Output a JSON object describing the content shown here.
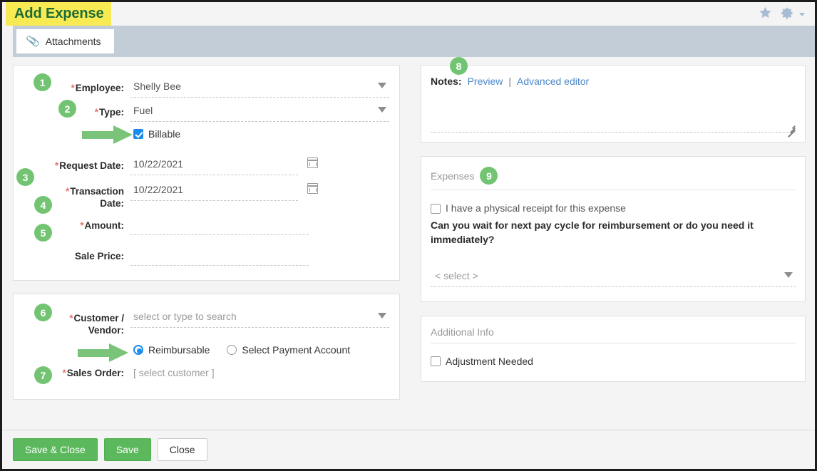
{
  "window": {
    "title": "Add Expense",
    "star_icon": "star-icon",
    "gear_icon": "gear-icon",
    "caret_icon": "chevron-down-icon"
  },
  "tabs": [
    {
      "label": "Attachments",
      "icon": "paperclip-icon",
      "active": true
    }
  ],
  "form": {
    "employee": {
      "badge": "1",
      "label": "Employee:",
      "required": true,
      "value": "Shelly Bee",
      "placeholder": ""
    },
    "type": {
      "badge": "2",
      "label": "Type:",
      "required": true,
      "value": "Fuel",
      "placeholder": ""
    },
    "billable": {
      "label": "Billable",
      "checked": true,
      "annotated": true
    },
    "request_date": {
      "badge": "3",
      "label": "Request Date:",
      "required": true,
      "value": "10/22/2021",
      "icon": "calendar-icon"
    },
    "transaction_date": {
      "badge": "4",
      "label_line1": "Transaction",
      "label_line2": "Date:",
      "required": true,
      "value": "10/22/2021",
      "icon": "calendar-icon"
    },
    "amount": {
      "badge": "5",
      "label": "Amount:",
      "required": true,
      "value": ""
    },
    "sale_price": {
      "label": "Sale Price:",
      "required": false,
      "value": ""
    },
    "customer_vendor": {
      "badge": "6",
      "label_line1": "Customer /",
      "label_line2": "Vendor:",
      "required": true,
      "value": "",
      "placeholder": "select or type to search"
    },
    "payment_mode": {
      "annotated": true,
      "options": [
        {
          "label": "Reimbursable",
          "selected": true
        },
        {
          "label": "Select Payment Account",
          "selected": false
        }
      ]
    },
    "sales_order": {
      "badge": "7",
      "label": "Sales Order:",
      "required": true,
      "value": "[ select customer ]"
    }
  },
  "notes": {
    "badge": "8",
    "label": "Notes:",
    "preview_link": "Preview",
    "separator": "|",
    "advanced_link": "Advanced editor",
    "value": ""
  },
  "expenses": {
    "badge": "9",
    "section_title": "Expenses",
    "receipt_checkbox": {
      "label": "I have a physical receipt for this expense",
      "checked": false
    },
    "question": "Can you wait for next pay cycle for reimbursement or do you need it immediately?",
    "answer_select": {
      "value": "< select >"
    }
  },
  "additional_info": {
    "section_title": "Additional Info",
    "adjustment_checkbox": {
      "label": "Adjustment Needed",
      "checked": false
    }
  },
  "footer": {
    "save_close_label": "Save & Close",
    "save_label": "Save",
    "close_label": "Close"
  },
  "colors": {
    "title_highlight": "#f7ea53",
    "title_text": "#1d6b36",
    "badge_green": "#72c472",
    "arrow_green": "#7ac47a",
    "button_green": "#5cb85c",
    "link_blue": "#4a86c8",
    "checkbox_blue": "#1a8cf0",
    "required_red": "#e8736a",
    "tabstrip_gray": "#c3cdd8"
  }
}
